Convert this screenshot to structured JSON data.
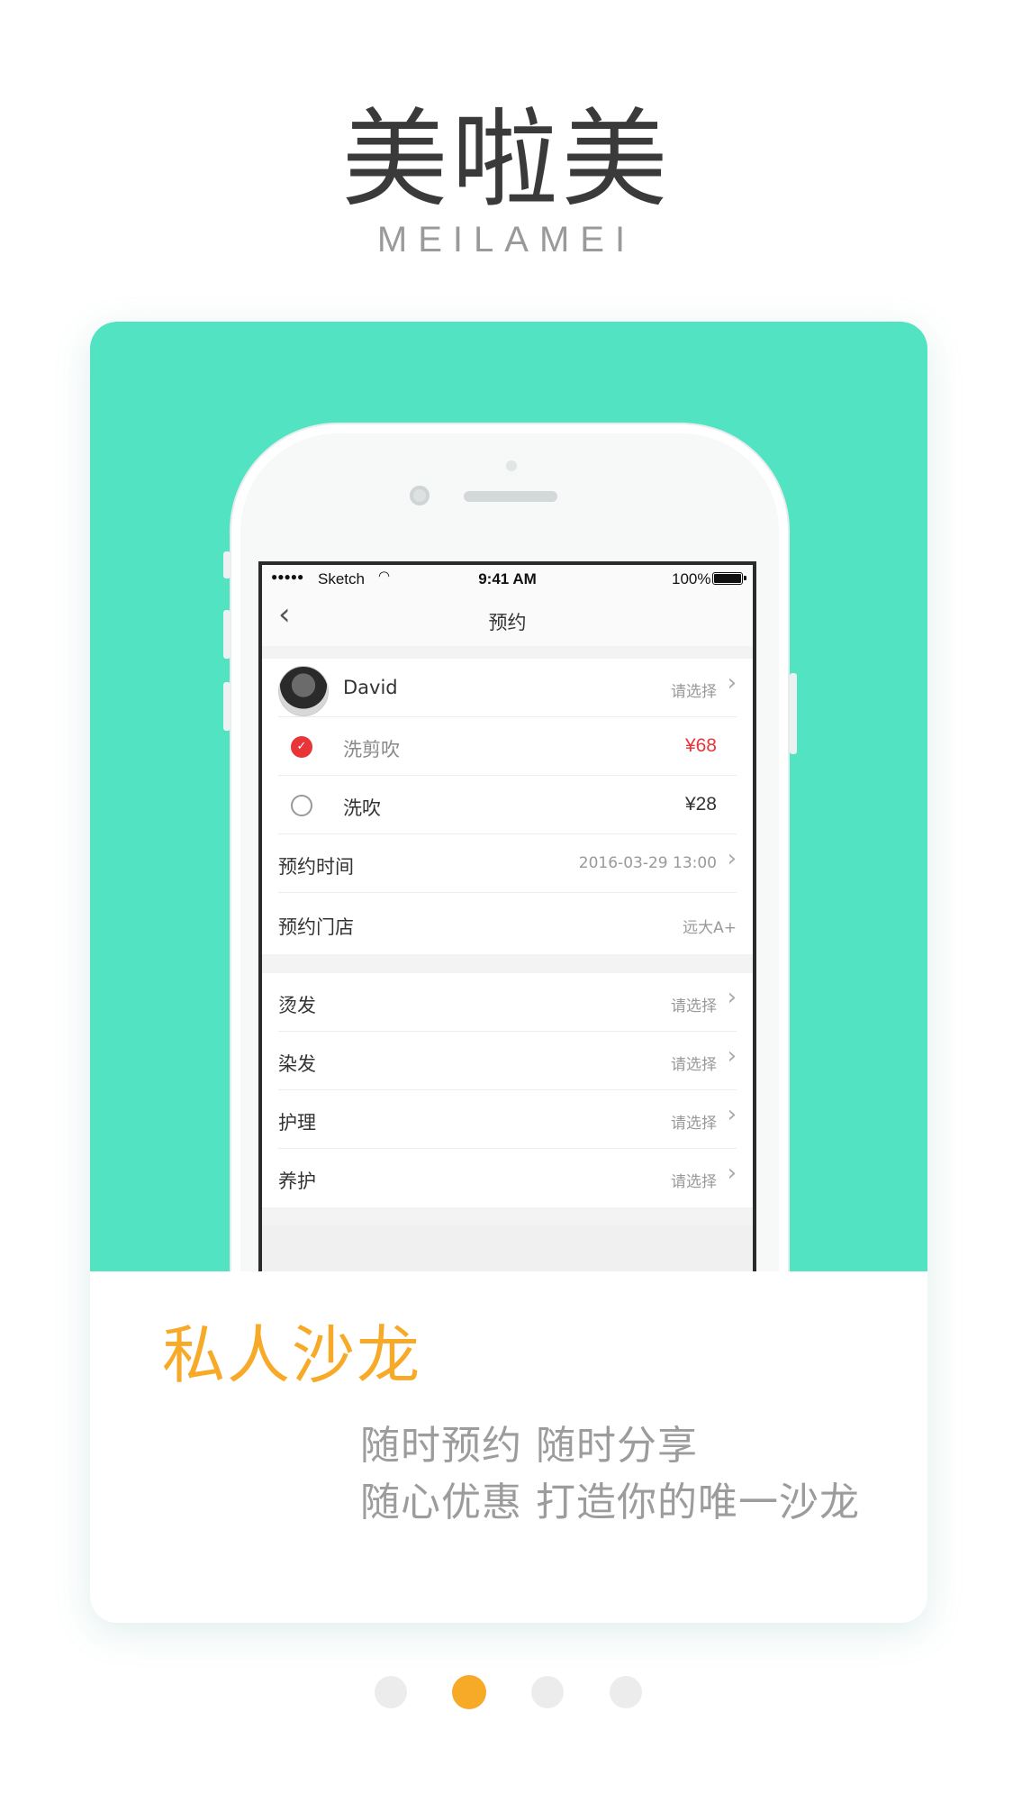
{
  "brand": {
    "title": "美啦美",
    "subtitle": "MEILAMEI"
  },
  "status_bar": {
    "signal": "●●●●●",
    "carrier": "Sketch",
    "time": "9:41 AM",
    "battery": "100%"
  },
  "nav": {
    "back_icon": "‹",
    "title": "预约"
  },
  "stylist": {
    "name": "David",
    "action": "请选择"
  },
  "services": [
    {
      "name": "洗剪吹",
      "price": "¥68",
      "selected": true
    },
    {
      "name": "洗吹",
      "price": "¥28",
      "selected": false
    }
  ],
  "appointment": {
    "time_label": "预约时间",
    "time_value": "2016-03-29 13:00",
    "store_label": "预约门店",
    "store_value": "远大A+"
  },
  "extras": [
    {
      "label": "烫发",
      "action": "请选择"
    },
    {
      "label": "染发",
      "action": "请选择"
    },
    {
      "label": "护理",
      "action": "请选择"
    },
    {
      "label": "养护",
      "action": "请选择"
    }
  ],
  "promo": {
    "title": "私人沙龙",
    "line1": "随时预约  随时分享",
    "line2": "随心优惠  打造你的唯一沙龙"
  },
  "pager": {
    "count": 4,
    "active": 2
  },
  "colors": {
    "accent_green": "#52e3c2",
    "accent_orange": "#f7a928",
    "price_red": "#e8353a"
  },
  "icons": {
    "check": "✓",
    "chevron": "›"
  }
}
